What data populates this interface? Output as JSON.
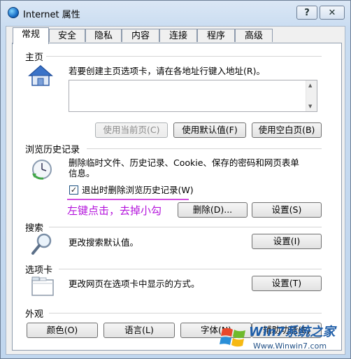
{
  "window": {
    "title": "Internet 属性",
    "help_label": "?",
    "close_label": "✕"
  },
  "tabs": [
    {
      "label": "常规",
      "active": true
    },
    {
      "label": "安全"
    },
    {
      "label": "隐私"
    },
    {
      "label": "内容"
    },
    {
      "label": "连接"
    },
    {
      "label": "程序"
    },
    {
      "label": "高级"
    }
  ],
  "homepage": {
    "title": "主页",
    "description": "若要创建主页选项卡，请在各地址行键入地址(R)。",
    "url_value": "",
    "use_current_label": "使用当前页(C)",
    "use_default_label": "使用默认值(F)",
    "use_blank_label": "使用空白页(B)"
  },
  "history": {
    "title": "浏览历史记录",
    "description_line1": "删除临时文件、历史记录、Cookie、保存的密码和网页表单",
    "description_line2": "信息。",
    "checkbox_label": "退出时删除浏览历史记录(W)",
    "checkbox_checked": true,
    "delete_label": "删除(D)...",
    "settings_label": "设置(S)"
  },
  "annotation": {
    "text": "左键点击，去掉小勾",
    "color": "#b414dc"
  },
  "search": {
    "title": "搜索",
    "description": "更改搜索默认值。",
    "settings_label": "设置(I)"
  },
  "tabs_section": {
    "title": "选项卡",
    "description": "更改网页在选项卡中显示的方式。",
    "settings_label": "设置(T)"
  },
  "appearance": {
    "title": "外观",
    "colors_label": "颜色(O)",
    "languages_label": "语言(L)",
    "fonts_label": "字体(N)",
    "accessibility_label": "辅助功能(E)"
  },
  "watermark": {
    "brand": "Win7系统之家",
    "url": "Www.Winwin7.com"
  }
}
